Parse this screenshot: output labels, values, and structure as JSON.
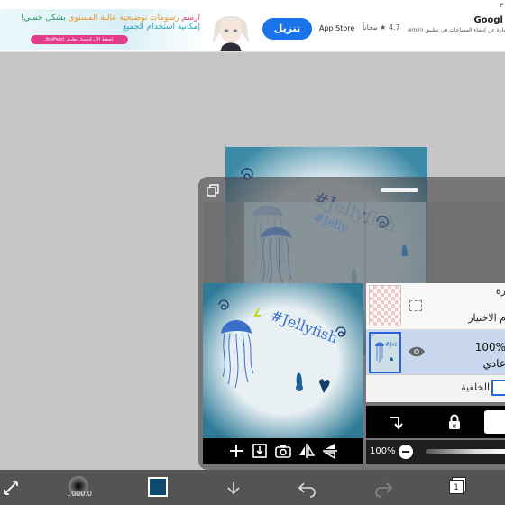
{
  "ad": {
    "top_mark": "٣",
    "title_part1": "ارسم ",
    "title_part2": "رسومات توضيحية عالية المستوى ",
    "title_part3": "بشكل حسي! ",
    "title_part4": "إمكانية استخدام الجميع",
    "pill_text": "اضغط الآن لتحميل تطبيق ibisPaint",
    "install_button": "تنزيل",
    "store_label": "App Store",
    "rating": "4.7",
    "rating_suffix": "مجاناً",
    "advertiser": "Googl",
    "description": "عبارة عن إنشاء المساحات في تطبيق Gemini من Google، على iPhone"
  },
  "panel": {
    "layer_selection_name_top": "رة",
    "layer_selection_name": "م الاختيار",
    "layer_opacity": "100%",
    "layer_blend_mode": "عادي",
    "background_label": "الخلفية",
    "opacity_label": "100%"
  },
  "bottom": {
    "brush_size": "1000.0",
    "layer_count": "1",
    "color": "#0c4a6e"
  },
  "colors": {
    "accent_blue": "#2a64d6",
    "install_blue": "#1a73e8",
    "drawing_blue": "#3a6fc9"
  },
  "icons": [
    "maximize-icon",
    "add-layer-icon",
    "import-layer-icon",
    "camera-icon",
    "flip-horizontal-icon",
    "flip-vertical-icon",
    "eye-icon",
    "merge-down-icon",
    "lock-alpha-icon",
    "transform-icon",
    "brush-icon",
    "download-icon",
    "undo-icon",
    "redo-icon",
    "layers-icon"
  ]
}
